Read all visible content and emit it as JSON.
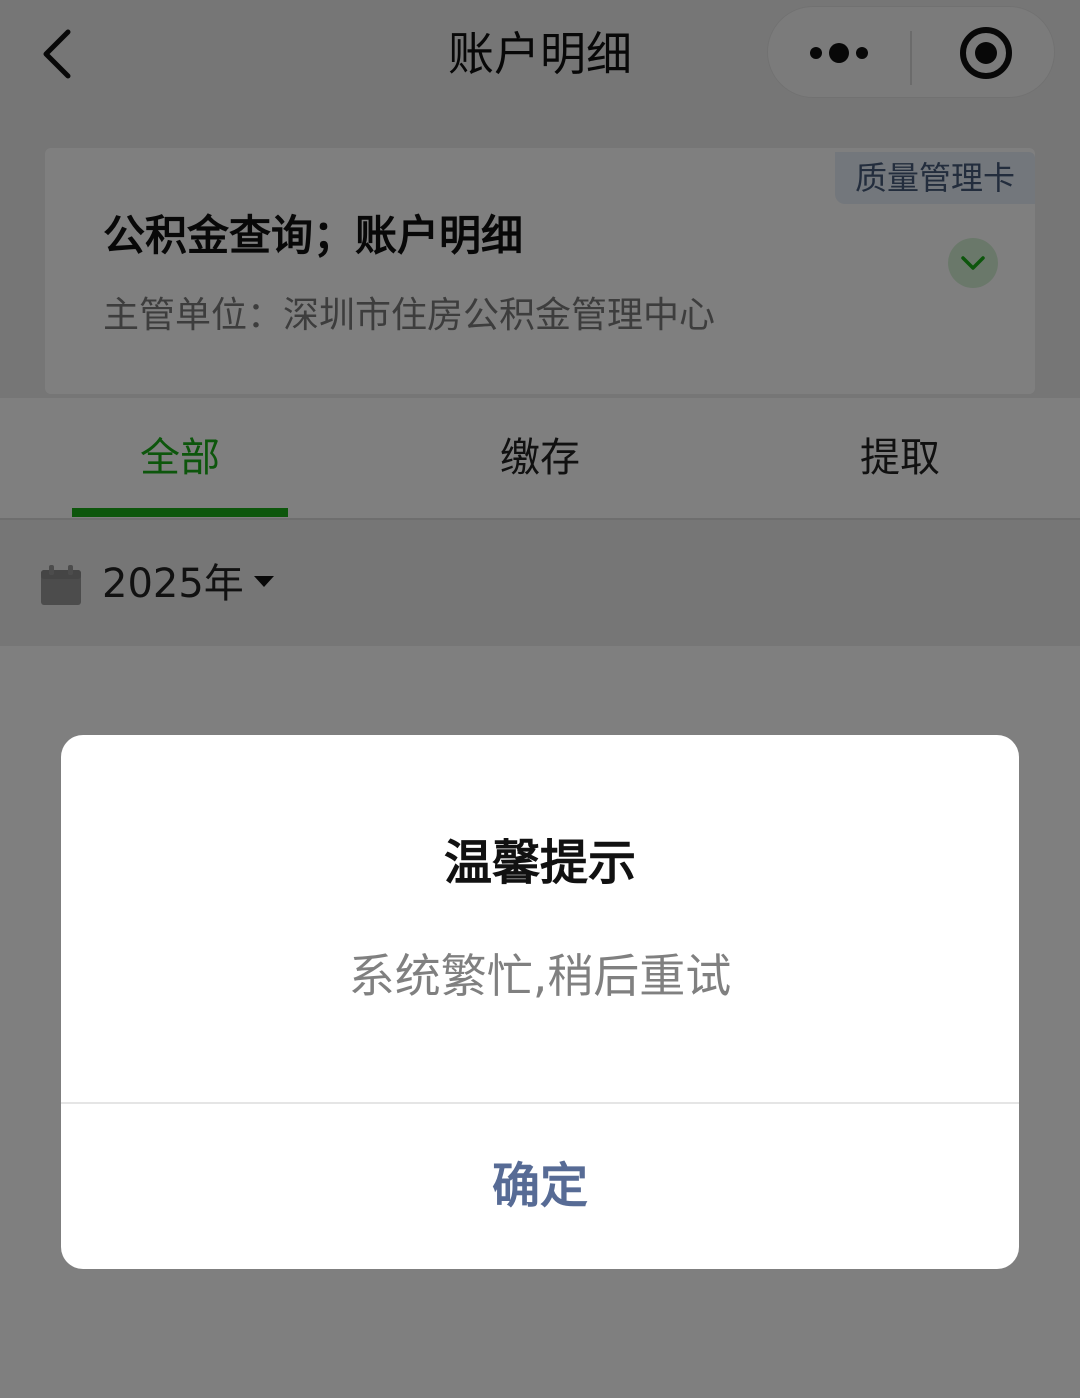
{
  "nav": {
    "title": "账户明细",
    "back_icon": "chevron-left-icon",
    "more_icon": "more-dots-icon",
    "close_icon": "target-close-icon"
  },
  "service_card": {
    "badge": "质量管理卡",
    "title": "公积金查询；账户明细",
    "subtitle": "主管单位：深圳市住房公积金管理中心",
    "expand_icon": "chevron-down-icon"
  },
  "tabs": [
    {
      "label": "全部",
      "active": true
    },
    {
      "label": "缴存",
      "active": false
    },
    {
      "label": "提取",
      "active": false
    }
  ],
  "filter": {
    "calendar_icon": "calendar-icon",
    "year": "2025年",
    "caret_icon": "caret-down-icon"
  },
  "modal": {
    "title": "温馨提示",
    "content": "系统繁忙,稍后重试",
    "confirm": "确定"
  },
  "colors": {
    "accent_green": "#1aad19",
    "link_blue": "#576b95",
    "mask": "rgba(0,0,0,0.5)"
  }
}
